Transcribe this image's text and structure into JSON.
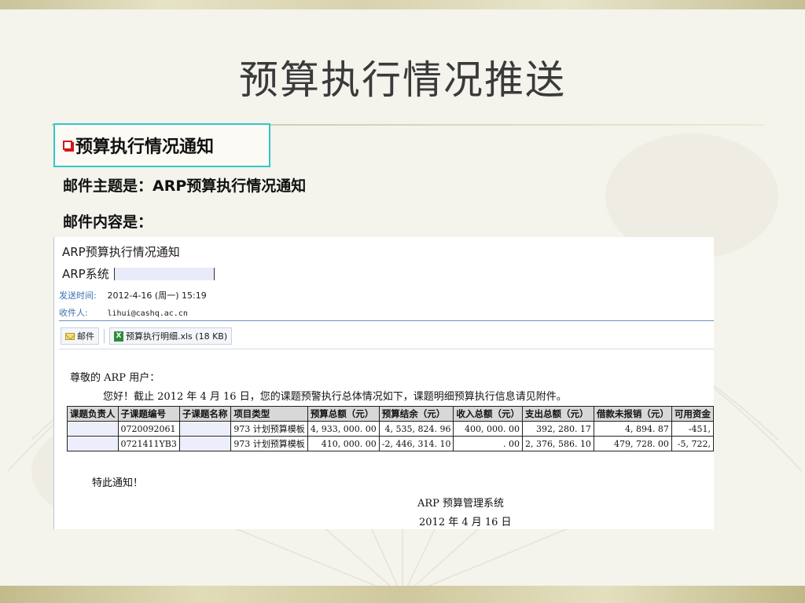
{
  "slide": {
    "title": "预算执行情况推送",
    "notice_heading": "预算执行情况通知",
    "subject_line": "邮件主题是：ARP预算执行情况通知",
    "content_line": "邮件内容是："
  },
  "email": {
    "subject": "ARP预算执行情况通知",
    "sender_name": "ARP系统",
    "sent_label": "发送时间:",
    "sent_value": "2012-4-16 (周一) 15:19",
    "to_label": "收件人:",
    "to_value": "lihui@cashq.ac.cn",
    "tab_mail": "邮件",
    "attachment": "预算执行明细.xls (18 KB)",
    "greeting": "尊敬的 ARP 用户：",
    "intro": "您好！截止 2012 年 4 月 16 日，您的课题预警执行总体情况如下，课题明细预算执行信息请见附件。",
    "closing": "特此通知！",
    "signature": "ARP 预算管理系统",
    "date": "2012 年 4 月 16 日"
  },
  "table": {
    "headers": [
      "课题负责人",
      "子课题编号",
      "子课题名称",
      "项目类型",
      "预算总额（元）",
      "预算结余（元）",
      "收入总额（元）",
      "支出总额（元）",
      "借款未报销（元）",
      "可用资金"
    ],
    "rows": [
      [
        "",
        "0720092061",
        "",
        "973 计划预算模板",
        "4, 933, 000. 00",
        "4, 535, 824. 96",
        "400, 000. 00",
        "392, 280. 17",
        "4, 894. 87",
        "-451,"
      ],
      [
        "",
        "0721411YB3",
        "",
        "973 计划预算模板",
        "410, 000. 00",
        "-2, 446, 314. 10",
        ". 00",
        "2, 376, 586. 10",
        "479, 728. 00",
        "-5, 722,"
      ]
    ]
  },
  "colors": {
    "notice_border": "#2ec8c8",
    "bullet": "#d4141c",
    "email_label": "#3b6fb6"
  },
  "icons": [
    "checkbox-bullet-icon",
    "mail-icon",
    "excel-icon"
  ]
}
